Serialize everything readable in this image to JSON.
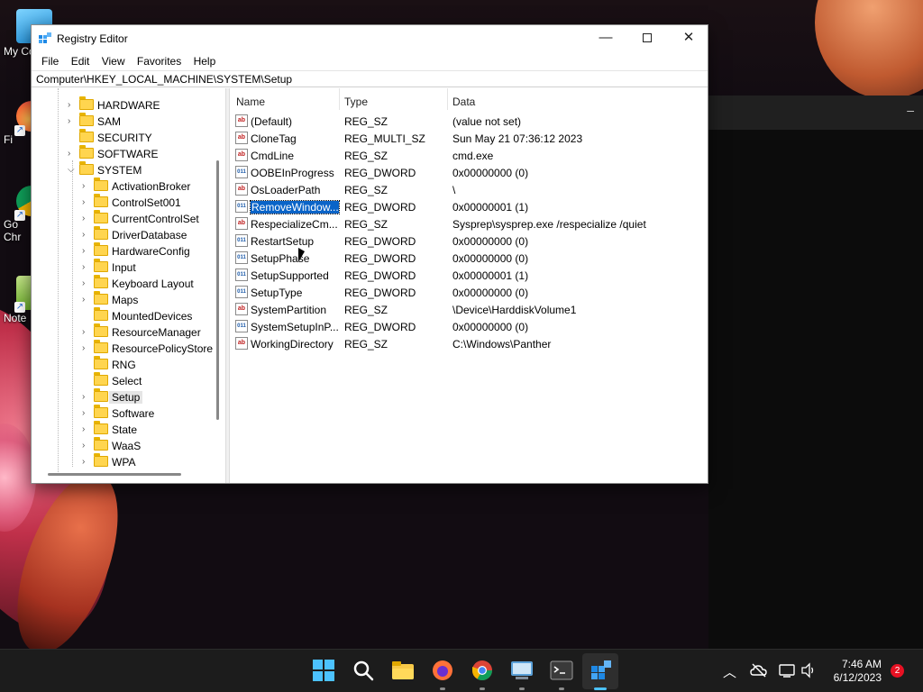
{
  "desktop": {
    "icons": [
      {
        "label": "My Co",
        "icon": "computer-icon"
      },
      {
        "label": "Fi",
        "icon": "firefox-icon"
      },
      {
        "label": "Go\nChr",
        "icon": "chrome-icon"
      },
      {
        "label": "Note",
        "icon": "notepad-icon"
      }
    ],
    "background_window_glyph": "–"
  },
  "window": {
    "title": "Registry Editor",
    "menu": [
      "File",
      "Edit",
      "View",
      "Favorites",
      "Help"
    ],
    "address": "Computer\\HKEY_LOCAL_MACHINE\\SYSTEM\\Setup"
  },
  "tree": [
    {
      "label": "HARDWARE",
      "level": 1,
      "expander": "collapsed"
    },
    {
      "label": "SAM",
      "level": 1,
      "expander": "collapsed"
    },
    {
      "label": "SECURITY",
      "level": 1,
      "expander": "none"
    },
    {
      "label": "SOFTWARE",
      "level": 1,
      "expander": "collapsed"
    },
    {
      "label": "SYSTEM",
      "level": 1,
      "expander": "expanded"
    },
    {
      "label": "ActivationBroker",
      "level": 2,
      "expander": "collapsed"
    },
    {
      "label": "ControlSet001",
      "level": 2,
      "expander": "collapsed"
    },
    {
      "label": "CurrentControlSet",
      "level": 2,
      "expander": "collapsed"
    },
    {
      "label": "DriverDatabase",
      "level": 2,
      "expander": "collapsed"
    },
    {
      "label": "HardwareConfig",
      "level": 2,
      "expander": "collapsed"
    },
    {
      "label": "Input",
      "level": 2,
      "expander": "collapsed"
    },
    {
      "label": "Keyboard Layout",
      "level": 2,
      "expander": "collapsed"
    },
    {
      "label": "Maps",
      "level": 2,
      "expander": "collapsed"
    },
    {
      "label": "MountedDevices",
      "level": 2,
      "expander": "none"
    },
    {
      "label": "ResourceManager",
      "level": 2,
      "expander": "collapsed"
    },
    {
      "label": "ResourcePolicyStore",
      "level": 2,
      "expander": "collapsed"
    },
    {
      "label": "RNG",
      "level": 2,
      "expander": "none"
    },
    {
      "label": "Select",
      "level": 2,
      "expander": "none"
    },
    {
      "label": "Setup",
      "level": 2,
      "expander": "collapsed",
      "selected": true
    },
    {
      "label": "Software",
      "level": 2,
      "expander": "collapsed"
    },
    {
      "label": "State",
      "level": 2,
      "expander": "collapsed"
    },
    {
      "label": "WaaS",
      "level": 2,
      "expander": "collapsed"
    },
    {
      "label": "WPA",
      "level": 2,
      "expander": "collapsed"
    }
  ],
  "list": {
    "columns": [
      "Name",
      "Type",
      "Data"
    ],
    "rows": [
      {
        "icon": "string-value-icon",
        "name": "(Default)",
        "type": "REG_SZ",
        "data": "(value not set)"
      },
      {
        "icon": "string-value-icon",
        "name": "CloneTag",
        "type": "REG_MULTI_SZ",
        "data": "Sun May 21 07:36:12 2023"
      },
      {
        "icon": "string-value-icon",
        "name": "CmdLine",
        "type": "REG_SZ",
        "data": "cmd.exe"
      },
      {
        "icon": "dword-value-icon",
        "name": "OOBEInProgress",
        "type": "REG_DWORD",
        "data": "0x00000000 (0)"
      },
      {
        "icon": "string-value-icon",
        "name": "OsLoaderPath",
        "type": "REG_SZ",
        "data": "\\"
      },
      {
        "icon": "dword-value-icon",
        "name": "RemoveWindow...",
        "type": "REG_DWORD",
        "data": "0x00000001 (1)",
        "selected": true
      },
      {
        "icon": "string-value-icon",
        "name": "RespecializeCm...",
        "type": "REG_SZ",
        "data": "Sysprep\\sysprep.exe /respecialize /quiet"
      },
      {
        "icon": "dword-value-icon",
        "name": "RestartSetup",
        "type": "REG_DWORD",
        "data": "0x00000000 (0)"
      },
      {
        "icon": "dword-value-icon",
        "name": "SetupPhase",
        "type": "REG_DWORD",
        "data": "0x00000000 (0)"
      },
      {
        "icon": "dword-value-icon",
        "name": "SetupSupported",
        "type": "REG_DWORD",
        "data": "0x00000001 (1)"
      },
      {
        "icon": "dword-value-icon",
        "name": "SetupType",
        "type": "REG_DWORD",
        "data": "0x00000000 (0)"
      },
      {
        "icon": "string-value-icon",
        "name": "SystemPartition",
        "type": "REG_SZ",
        "data": "\\Device\\HarddiskVolume1"
      },
      {
        "icon": "dword-value-icon",
        "name": "SystemSetupInP...",
        "type": "REG_DWORD",
        "data": "0x00000000 (0)"
      },
      {
        "icon": "string-value-icon",
        "name": "WorkingDirectory",
        "type": "REG_SZ",
        "data": "C:\\Windows\\Panther"
      }
    ]
  },
  "taskbar": {
    "apps": [
      "start-icon",
      "search-icon",
      "file-explorer-icon",
      "firefox-icon",
      "chrome-icon",
      "remote-desktop-icon",
      "terminal-icon",
      "registry-editor-icon"
    ],
    "clock_time": "7:46 AM",
    "clock_date": "6/12/2023",
    "notification_count": "2"
  },
  "colors": {
    "selection": "#0a64c8",
    "folder": "#ffd54f",
    "taskbar": "#1c1c1c",
    "accent": "#4cc2ff"
  }
}
